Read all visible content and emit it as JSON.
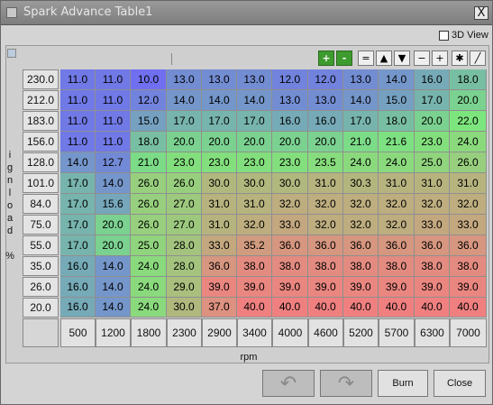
{
  "window": {
    "title": "Spark Advance Table1",
    "close_label": "X"
  },
  "view3d_label": "3D View",
  "toolbar": [
    {
      "name": "increment-icon",
      "glyph": "+"
    },
    {
      "name": "decrement-icon",
      "glyph": "-"
    },
    {
      "name": "equals-button",
      "glyph": "="
    },
    {
      "name": "up-arrow-button",
      "glyph": "▲"
    },
    {
      "name": "down-arrow-button",
      "glyph": "▼"
    },
    {
      "name": "minus-button",
      "glyph": "−"
    },
    {
      "name": "plus-button",
      "glyph": "+"
    },
    {
      "name": "multiply-button",
      "glyph": "✱"
    },
    {
      "name": "interpolate-button",
      "glyph": "╱"
    }
  ],
  "y_axis_label": [
    "i",
    "g",
    "n",
    "l",
    "o",
    "a",
    "d",
    "",
    "%"
  ],
  "y_axis": [
    "230.0",
    "212.0",
    "183.0",
    "156.0",
    "128.0",
    "101.0",
    "84.0",
    "75.0",
    "55.0",
    "35.0",
    "26.0",
    "20.0"
  ],
  "x_axis": [
    "500",
    "1200",
    "1800",
    "2300",
    "2900",
    "3400",
    "4000",
    "4600",
    "5200",
    "5700",
    "6300",
    "7000"
  ],
  "x_axis_label": "rpm",
  "table": [
    [
      "11.0",
      "11.0",
      "10.0",
      "13.0",
      "13.0",
      "13.0",
      "12.0",
      "12.0",
      "13.0",
      "14.0",
      "16.0",
      "18.0"
    ],
    [
      "11.0",
      "11.0",
      "12.0",
      "14.0",
      "14.0",
      "14.0",
      "13.0",
      "13.0",
      "14.0",
      "15.0",
      "17.0",
      "20.0"
    ],
    [
      "11.0",
      "11.0",
      "15.0",
      "17.0",
      "17.0",
      "17.0",
      "16.0",
      "16.0",
      "17.0",
      "18.0",
      "20.0",
      "22.0"
    ],
    [
      "11.0",
      "11.0",
      "18.0",
      "20.0",
      "20.0",
      "20.0",
      "20.0",
      "20.0",
      "21.0",
      "21.6",
      "23.0",
      "24.0"
    ],
    [
      "14.0",
      "12.7",
      "21.0",
      "23.0",
      "23.0",
      "23.0",
      "23.0",
      "23.5",
      "24.0",
      "24.0",
      "25.0",
      "26.0"
    ],
    [
      "17.0",
      "14.0",
      "26.0",
      "26.0",
      "30.0",
      "30.0",
      "30.0",
      "31.0",
      "30.3",
      "31.0",
      "31.0",
      "31.0"
    ],
    [
      "17.0",
      "15.6",
      "26.0",
      "27.0",
      "31.0",
      "31.0",
      "32.0",
      "32.0",
      "32.0",
      "32.0",
      "32.0",
      "32.0"
    ],
    [
      "17.0",
      "20.0",
      "26.0",
      "27.0",
      "31.0",
      "32.0",
      "33.0",
      "32.0",
      "32.0",
      "32.0",
      "33.0",
      "33.0"
    ],
    [
      "17.0",
      "20.0",
      "25.0",
      "28.0",
      "33.0",
      "35.2",
      "36.0",
      "36.0",
      "36.0",
      "36.0",
      "36.0",
      "36.0"
    ],
    [
      "16.0",
      "14.0",
      "24.0",
      "28.0",
      "36.0",
      "38.0",
      "38.0",
      "38.0",
      "38.0",
      "38.0",
      "38.0",
      "38.0"
    ],
    [
      "16.0",
      "14.0",
      "24.0",
      "29.0",
      "39.0",
      "39.0",
      "39.0",
      "39.0",
      "39.0",
      "39.0",
      "39.0",
      "39.0"
    ],
    [
      "16.0",
      "14.0",
      "24.0",
      "30.0",
      "37.0",
      "40.0",
      "40.0",
      "40.0",
      "40.0",
      "40.0",
      "40.0",
      "40.0"
    ]
  ],
  "buttons": {
    "burn": "Burn",
    "close": "Close"
  },
  "colors": {
    "low": "#6f6ff0",
    "mid": "#7de57d",
    "high": "#f08080"
  }
}
